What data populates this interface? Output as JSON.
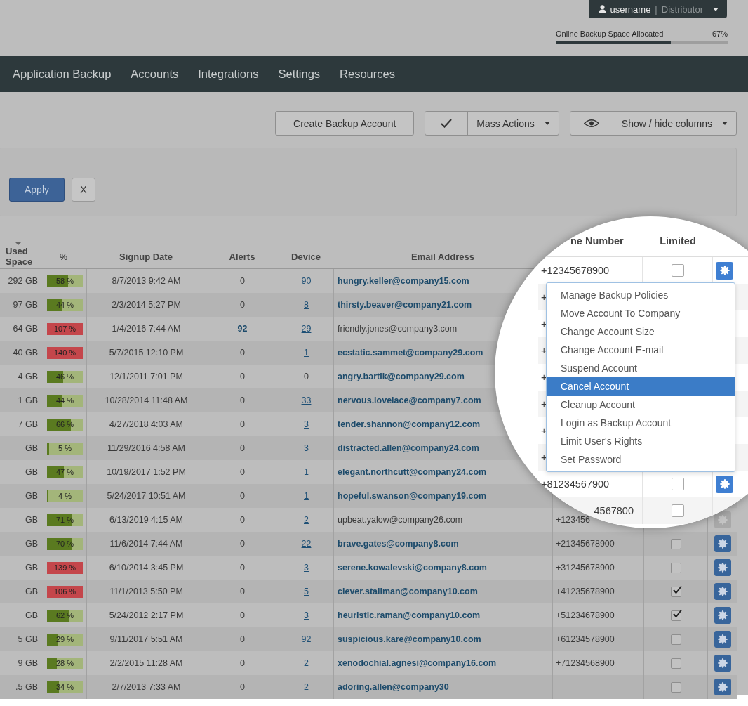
{
  "user_menu": {
    "username": "username",
    "separator": "|",
    "role": "Distributor"
  },
  "storage": {
    "label": "Online Backup Space Allocated",
    "reading": "67%",
    "level": 0.67
  },
  "nav": [
    {
      "label": "Application Backup",
      "selected": false
    },
    {
      "label": "Accounts",
      "selected": false
    },
    {
      "label": "Integrations",
      "selected": false
    },
    {
      "label": "Settings",
      "selected": false
    },
    {
      "label": "Resources",
      "selected": false
    }
  ],
  "toolbar": {
    "create_button": "Create Backup Account",
    "mass_actions": "Mass Actions",
    "columns_button": "Show / hide columns"
  },
  "filter": {
    "apply": "Apply",
    "clear": "X"
  },
  "table": {
    "columns": [
      "Used Space",
      "%",
      "Signup Date",
      "Alerts",
      "Device",
      "Email Address"
    ],
    "rows": [
      {
        "used": "292 GB",
        "percent": "58 %",
        "level": 0.58,
        "over": false,
        "date": "8/7/2013 9:42 AM",
        "alerts": "0",
        "alert_flag": false,
        "device": "90",
        "device_link": true,
        "email": "hungry.keller@company15.com",
        "email_bold": true
      },
      {
        "used": "97 GB",
        "percent": "44 %",
        "level": 0.44,
        "over": false,
        "date": "2/3/2014 5:27 PM",
        "alerts": "0",
        "alert_flag": false,
        "device": "8",
        "device_link": true,
        "email": "thirsty.beaver@company21.com",
        "email_bold": true
      },
      {
        "used": "64 GB",
        "percent": "107 %",
        "level": 1,
        "over": true,
        "date": "1/4/2016 7:44 AM",
        "alerts": "92",
        "alert_flag": true,
        "device": "29",
        "device_link": true,
        "email": "friendly.jones@company3.com",
        "email_bold": false
      },
      {
        "used": "40 GB",
        "percent": "140 %",
        "level": 1,
        "over": true,
        "date": "5/7/2015 12:10 PM",
        "alerts": "0",
        "alert_flag": false,
        "device": "1",
        "device_link": true,
        "email": "ecstatic.sammet@company29.com",
        "email_bold": true
      },
      {
        "used": "4 GB",
        "percent": "46 %",
        "level": 0.46,
        "over": false,
        "date": "12/1/2011 7:01 PM",
        "alerts": "0",
        "alert_flag": false,
        "device": "0",
        "device_link": false,
        "email": "angry.bartik@company29.com",
        "email_bold": true
      },
      {
        "used": "1 GB",
        "percent": "44 %",
        "level": 0.44,
        "over": false,
        "date": "10/28/2014 11:48 AM",
        "alerts": "0",
        "alert_flag": false,
        "device": "33",
        "device_link": true,
        "email": "nervous.lovelace@company7.com",
        "email_bold": true
      },
      {
        "used": "7 GB",
        "percent": "66 %",
        "level": 0.66,
        "over": false,
        "date": "4/27/2018 4:03 AM",
        "alerts": "0",
        "alert_flag": false,
        "device": "3",
        "device_link": true,
        "email": "tender.shannon@company12.com",
        "email_bold": true
      },
      {
        "used": "GB",
        "percent": "5 %",
        "level": 0.05,
        "over": false,
        "date": "11/29/2016 4:58 AM",
        "alerts": "0",
        "alert_flag": false,
        "device": "3",
        "device_link": true,
        "email": "distracted.allen@company24.com",
        "email_bold": true
      },
      {
        "used": "GB",
        "percent": "47 %",
        "level": 0.47,
        "over": false,
        "date": "10/19/2017 1:52 PM",
        "alerts": "0",
        "alert_flag": false,
        "device": "1",
        "device_link": true,
        "email": "elegant.northcutt@company24.com",
        "email_bold": true
      },
      {
        "used": "GB",
        "percent": "4 %",
        "level": 0.04,
        "over": false,
        "date": "5/24/2017 10:51 AM",
        "alerts": "0",
        "alert_flag": false,
        "device": "1",
        "device_link": true,
        "email": "hopeful.swanson@company19.com",
        "email_bold": true
      },
      {
        "used": "GB",
        "percent": "71 %",
        "level": 0.71,
        "over": false,
        "date": "6/13/2019 4:15 AM",
        "alerts": "0",
        "alert_flag": false,
        "device": "2",
        "device_link": true,
        "email": "upbeat.yalow@company26.com",
        "email_bold": false,
        "phone": "+123456",
        "settings_disabled": true
      },
      {
        "used": "GB",
        "percent": "70 %",
        "level": 0.7,
        "over": false,
        "date": "11/6/2014 7:44 AM",
        "alerts": "0",
        "alert_flag": false,
        "device": "22",
        "device_link": true,
        "email": "brave.gates@company8.com",
        "email_bold": true,
        "phone": "+21345678900",
        "limited": false,
        "settings_disabled": false
      },
      {
        "used": "GB",
        "percent": "139 %",
        "level": 1,
        "over": true,
        "date": "6/10/2014 3:45 PM",
        "alerts": "0",
        "alert_flag": false,
        "device": "3",
        "device_link": true,
        "email": "serene.kowalevski@company8.com",
        "email_bold": true,
        "phone": "+31245678900",
        "limited": false,
        "settings_disabled": false
      },
      {
        "used": "GB",
        "percent": "106 %",
        "level": 1,
        "over": true,
        "date": "11/1/2013 5:50 PM",
        "alerts": "0",
        "alert_flag": false,
        "device": "5",
        "device_link": true,
        "email": "clever.stallman@company10.com",
        "email_bold": true,
        "phone": "+41235678900",
        "limited": true,
        "settings_disabled": false
      },
      {
        "used": "GB",
        "percent": "62 %",
        "level": 0.62,
        "over": false,
        "date": "5/24/2012 2:17 PM",
        "alerts": "0",
        "alert_flag": false,
        "device": "3",
        "device_link": true,
        "email": "heuristic.raman@company10.com",
        "email_bold": true,
        "phone": "+51234678900",
        "limited": true,
        "settings_disabled": false
      },
      {
        "used": "5 GB",
        "percent": "29 %",
        "level": 0.29,
        "over": false,
        "date": "9/11/2017 5:51 AM",
        "alerts": "0",
        "alert_flag": false,
        "device": "92",
        "device_link": true,
        "email": "suspicious.kare@company10.com",
        "email_bold": true,
        "phone": "+61234578900",
        "limited": false,
        "settings_disabled": false
      },
      {
        "used": "9 GB",
        "percent": "28 %",
        "level": 0.28,
        "over": false,
        "date": "2/2/2015 11:28 AM",
        "alerts": "0",
        "alert_flag": false,
        "device": "2",
        "device_link": true,
        "email": "xenodochial.agnesi@company16.com",
        "email_bold": true,
        "phone": "+71234568900",
        "limited": false,
        "settings_disabled": false
      },
      {
        "used": ".5 GB",
        "percent": "34 %",
        "level": 0.34,
        "over": false,
        "date": "2/7/2013 7:33 AM",
        "alerts": "0",
        "alert_flag": false,
        "device": "2",
        "device_link": true,
        "email": "adoring.allen@company30",
        "email_bold": true,
        "limited": false,
        "settings_disabled": false
      }
    ]
  },
  "magnifier": {
    "columns": [
      "ne Number",
      "Limited"
    ],
    "rows": [
      {
        "phone": "+12345678900",
        "limited": false,
        "settings": true
      },
      {
        "phone": "+"
      },
      {
        "phone": "+"
      },
      {
        "phone": "+"
      },
      {
        "phone": "+"
      },
      {
        "phone": "+"
      },
      {
        "phone": "+"
      },
      {
        "phone": "+"
      },
      {
        "phone": "+81234567900",
        "limited": false,
        "settings": true
      },
      {
        "phone": "4567800",
        "kind": "clipped",
        "limited": false
      }
    ],
    "menu": [
      {
        "label": "Manage Backup Policies",
        "selected": false
      },
      {
        "label": "Move Account To Company",
        "selected": false
      },
      {
        "label": "Change Account Size",
        "selected": false
      },
      {
        "label": "Change Account E-mail",
        "selected": false
      },
      {
        "label": "Suspend Account",
        "selected": false
      },
      {
        "label": "Cancel Account",
        "selected": true
      },
      {
        "label": "Cleanup Account",
        "selected": false
      },
      {
        "label": "Login as Backup Account",
        "selected": false
      },
      {
        "label": "Limit User's Rights",
        "selected": false
      },
      {
        "label": "Set Password",
        "selected": false
      }
    ]
  }
}
